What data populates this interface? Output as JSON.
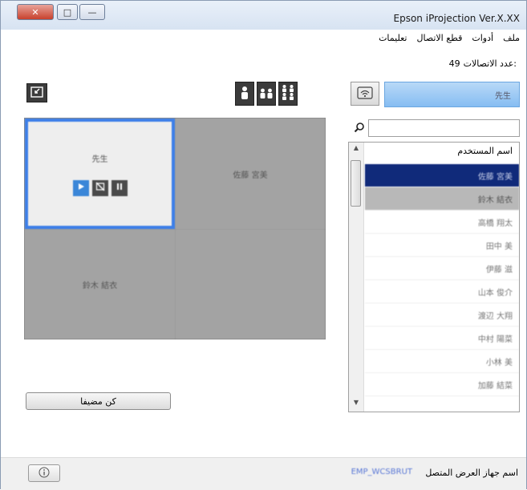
{
  "window": {
    "title": "Epson iProjection Ver.X.XX",
    "controls": {
      "close": "✕",
      "maximize": "□",
      "minimize": "—"
    }
  },
  "menu": [
    "ملف",
    "أدوات",
    "قطع الاتصال",
    "تعليمات"
  ],
  "connections": {
    "label": "عدد الاتصالات:",
    "count": "49"
  },
  "toolbar": {
    "destination_icon": "exit-fullscreen-icon",
    "layout_icons": [
      "single-user-icon",
      "two-users-icon",
      "four-users-icon"
    ]
  },
  "grid": {
    "cells": [
      {
        "name": "先生",
        "active": true,
        "controls": [
          "play-icon",
          "stop-projection-icon",
          "pause-icon"
        ]
      },
      {
        "name": "佐藤 宮美"
      },
      {
        "name": "鈴木 結衣"
      },
      {
        "name": ""
      }
    ]
  },
  "presenter_button": "كن مضيفا",
  "self": {
    "name": "先生",
    "icon": "wireless-projector-icon"
  },
  "search": {
    "placeholder": "",
    "icon": "search-icon"
  },
  "userlist": {
    "header": "اسم المستخدم",
    "rows": [
      {
        "name": "佐藤 宮美",
        "state": "selected"
      },
      {
        "name": "鈴木 結衣",
        "state": "alt"
      },
      {
        "name": "高橋 翔太",
        "state": ""
      },
      {
        "name": "田中 美",
        "state": ""
      },
      {
        "name": "伊藤 滋",
        "state": ""
      },
      {
        "name": "山本 俊介",
        "state": ""
      },
      {
        "name": "渡辺 大翔",
        "state": ""
      },
      {
        "name": "中村 陽菜",
        "state": ""
      },
      {
        "name": "小林 美",
        "state": ""
      },
      {
        "name": "加藤 結菜",
        "state": ""
      }
    ]
  },
  "status": {
    "info_icon": "info-icon",
    "connected_label": "اسم جهاز العرض المتصل",
    "connected_value": "EMP_WCSBRUT"
  }
}
